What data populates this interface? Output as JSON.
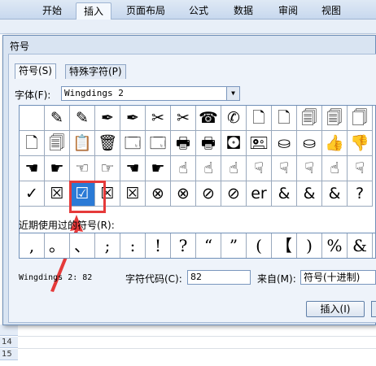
{
  "ribbon": {
    "tabs": [
      {
        "label": "开始"
      },
      {
        "label": "插入"
      },
      {
        "label": "页面布局"
      },
      {
        "label": "公式"
      },
      {
        "label": "数据"
      },
      {
        "label": "审阅"
      },
      {
        "label": "视图"
      }
    ],
    "active_tab": "插入"
  },
  "sheet": {
    "row_numbers": [
      "14",
      "15"
    ]
  },
  "dialog": {
    "title": "符号",
    "tabs": [
      {
        "label": "符号(S)"
      },
      {
        "label": "特殊字符(P)"
      }
    ],
    "font_label": "字体(F):",
    "font_value": "Wingdings 2",
    "symbols": [
      [
        "",
        "✎",
        "✎",
        "✒",
        "✒",
        "✂",
        "✂",
        "☎",
        "✆",
        "🗋",
        "🗋",
        "🗐",
        "🗐",
        "🗍"
      ],
      [
        "🗋",
        "🗐",
        "📋",
        "🗑",
        "🗔",
        "🗔",
        "🖶",
        "🖶",
        "🖸",
        "🖭",
        "⛀",
        "⛀",
        "👍",
        "👎"
      ],
      [
        "☚",
        "☛",
        "☜",
        "☞",
        "☚",
        "☛",
        "☝",
        "☝",
        "☝",
        "☟",
        "☟",
        "☟",
        "☝",
        "☟"
      ],
      [
        "✓",
        "☒",
        "☑",
        "☒",
        "☒",
        "⊗",
        "⊗",
        "⊘",
        "⊘",
        "er",
        "&",
        "&",
        "&",
        "?"
      ]
    ],
    "selected_symbol": "☑",
    "recent_label": "近期使用过的符号(R):",
    "recent_symbols": [
      ",",
      "。",
      "、",
      ";",
      ":",
      "!",
      "?",
      "“",
      "”",
      "(",
      "【",
      ")",
      "%",
      "&"
    ],
    "info_text": "Wingdings 2: 82",
    "code_label": "字符代码(C):",
    "code_value": "82",
    "from_label": "来自(M):",
    "from_value": "符号(十进制)",
    "insert_label": "插入(I)"
  },
  "colors": {
    "selection": "#2a7ad6",
    "highlight": "#e53a3a"
  }
}
